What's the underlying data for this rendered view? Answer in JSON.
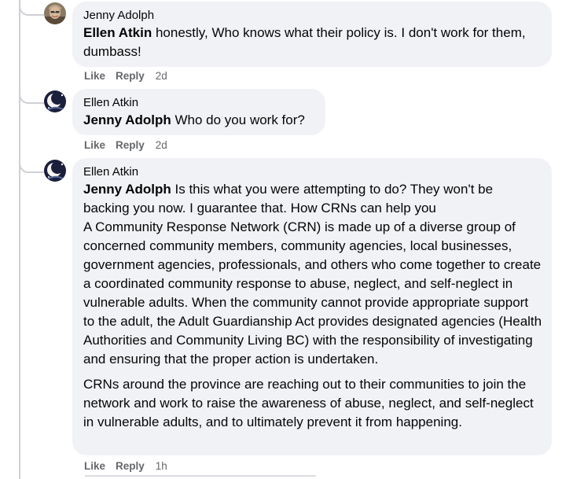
{
  "comments": [
    {
      "author": "Jenny Adolph",
      "mention": "Ellen Atkin",
      "text": "honestly, Who knows what their policy is. I don't work for them, dumbass!",
      "like_label": "Like",
      "reply_label": "Reply",
      "time": "2d"
    },
    {
      "author": "Ellen Atkin",
      "mention": "Jenny Adolph",
      "text": "Who do you work for?",
      "like_label": "Like",
      "reply_label": "Reply",
      "time": "2d"
    },
    {
      "author": "Ellen Atkin",
      "mention": "Jenny Adolph",
      "text": "Is this what you were attempting to do? They won't be backing you now. I guarantee that. How CRNs can help you",
      "paragraph1": "A Community Response Network (CRN) is made up of a diverse group of concerned community members, community agencies, local businesses, government agencies, professionals, and others who come together to create a coordinated community response to abuse, neglect, and self-neglect in vulnerable adults. When the community cannot provide appropriate support to the adult, the Adult Guardianship Act provides designated agencies (Health Authorities and Community Living BC) with the responsibility of investigating and ensuring that the proper action is undertaken.",
      "paragraph2": "CRNs around the province are reaching out to their communities to join the network and work to raise the awareness of abuse, neglect, and self-neglect in vulnerable adults, and to ultimately prevent it from happening.",
      "like_label": "Like",
      "reply_label": "Reply",
      "time": "1h"
    }
  ],
  "colors": {
    "bubble": "#f0f2f5",
    "secondary_text": "#65676b",
    "primary_text": "#050505",
    "thread_line": "#ced0d4"
  },
  "icons": {
    "avatar_jenny": "avatar-photo-man",
    "avatar_ellen": "avatar-photo-moon"
  }
}
